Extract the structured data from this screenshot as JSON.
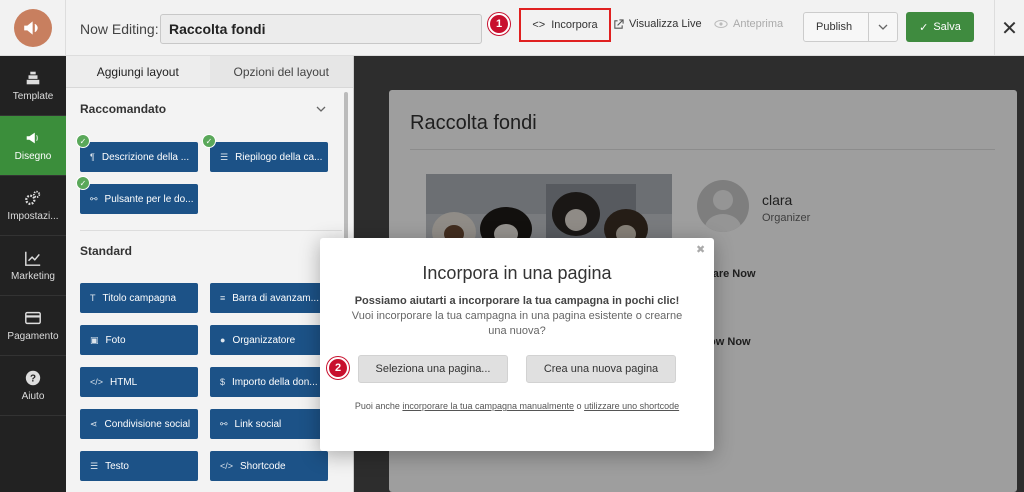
{
  "topbar": {
    "now_editing_label": "Now Editing:",
    "campaign_title": "Raccolta fondi",
    "step1": "1",
    "incorpora": "Incorpora",
    "visualizza_live": "Visualizza Live",
    "anteprima": "Anteprima",
    "publish": "Publish",
    "salva": "Salva"
  },
  "nav": [
    {
      "label": "Template",
      "icon": "template-icon"
    },
    {
      "label": "Disegno",
      "icon": "megaphone-icon"
    },
    {
      "label": "Impostazi...",
      "icon": "gears-icon"
    },
    {
      "label": "Marketing",
      "icon": "chart-line-icon"
    },
    {
      "label": "Pagamento",
      "icon": "credit-card-icon"
    },
    {
      "label": "Aiuto",
      "icon": "help-icon"
    }
  ],
  "panel": {
    "tabs": [
      "Aggiungi layout",
      "Opzioni del layout"
    ],
    "recommended_heading": "Raccomandato",
    "standard_heading": "Standard",
    "recommended_blocks": [
      "Descrizione della ...",
      "Riepilogo della ca...",
      "Pulsante per le do..."
    ],
    "standard_blocks": [
      "Titolo campagna",
      "Barra di avanzam...",
      "Foto",
      "Organizzatore",
      "HTML",
      "Importo della don...",
      "Condivisione social",
      "Link social",
      "Testo",
      "Shortcode"
    ]
  },
  "preview": {
    "title": "Raccolta fondi",
    "organizer_name": "clara",
    "organizer_role": "Organizer",
    "share_now": "hare Now",
    "follow_now": "low Now"
  },
  "modal": {
    "title": "Incorpora in una pagina",
    "body_bold": "Possiamo aiutarti a incorporare la tua campagna in pochi clic!",
    "body_rest": "Vuoi incorporare la tua campagna in una pagina esistente o crearne una nuova?",
    "step2": "2",
    "select_page": "Seleziona una pagina...",
    "create_page": "Crea una nuova pagina",
    "foot_prefix": "Puoi anche",
    "foot_link1": "incorporare la tua campagna manualmente",
    "foot_mid": "o",
    "foot_link2": "utilizzare uno shortcode"
  },
  "colors": {
    "accent_green": "#3f8b3f",
    "block_blue": "#1c5287",
    "highlight_red": "#e02020"
  }
}
